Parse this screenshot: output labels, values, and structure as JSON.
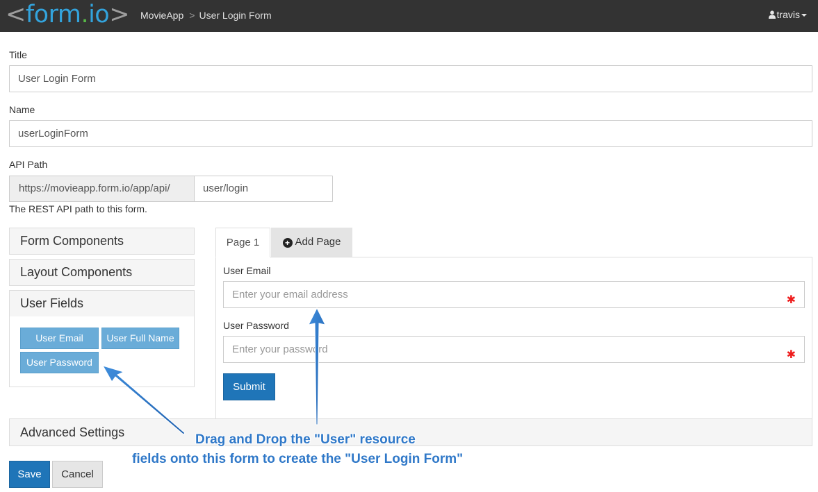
{
  "header": {
    "logo": {
      "open_bracket": "<",
      "form": "form",
      "dot": ".",
      "io": "io",
      "close_bracket": ">"
    },
    "breadcrumb": {
      "project": "MovieApp",
      "separator": ">",
      "page": "User Login Form"
    },
    "user": {
      "name": "travis",
      "icon": "user-icon"
    }
  },
  "form": {
    "title": {
      "label": "Title",
      "value": "User Login Form"
    },
    "name": {
      "label": "Name",
      "value": "userLoginForm"
    },
    "api_path": {
      "label": "API Path",
      "prefix": "https://movieapp.form.io/app/api/",
      "value": "user/login",
      "help": "The REST API path to this form."
    }
  },
  "sidebar": {
    "panels": [
      {
        "label": "Form Components"
      },
      {
        "label": "Layout Components"
      },
      {
        "label": "User Fields"
      }
    ],
    "user_fields": [
      "User Email",
      "User Full Name",
      "User Password"
    ]
  },
  "builder": {
    "tabs": {
      "active": "Page 1",
      "add": "Add Page",
      "add_icon": "plus-circle-icon"
    },
    "fields": [
      {
        "label": "User Email",
        "placeholder": "Enter your email address",
        "required": true
      },
      {
        "label": "User Password",
        "placeholder": "Enter your password",
        "required": true
      }
    ],
    "submit_label": "Submit",
    "required_marker": "✱"
  },
  "advanced": {
    "label": "Advanced Settings"
  },
  "actions": {
    "save": "Save",
    "cancel": "Cancel"
  },
  "annotation": {
    "line1": "Drag and Drop the \"User\" resource",
    "line2": "fields onto this form to create the \"User Login Form\""
  },
  "colors": {
    "navbar": "#333333",
    "primary": "#1f75b8",
    "field_button": "#6aacd8",
    "annotation": "#2f78c8",
    "required": "#ee1b1b"
  }
}
